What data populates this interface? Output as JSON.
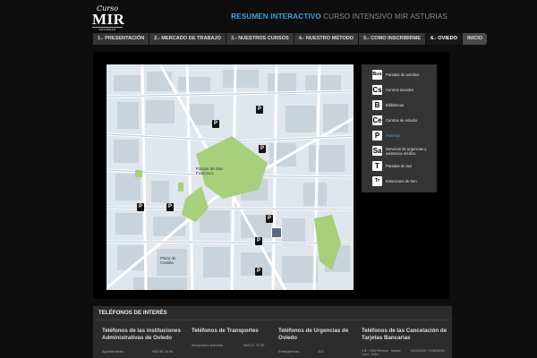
{
  "logo": {
    "script": "Curso",
    "big": "MIR",
    "small": "ASTURIAS"
  },
  "header": {
    "highlight": "RESUMEN INTERACTIVO",
    "rest": "CURSO INTENSIVO MIR ASTURIAS"
  },
  "nav": [
    {
      "label": "1.- PRESENTACIÓN"
    },
    {
      "label": "2.- MERCADO DE TRABAJO"
    },
    {
      "label": "3.- NUESTROS CURSOS"
    },
    {
      "label": "4.- NUESTRO MÉTODO"
    },
    {
      "label": "5.- COMO INSCRIBIRME"
    },
    {
      "label": "6.- OVIEDO"
    },
    {
      "label": "INICIO"
    }
  ],
  "legend": [
    {
      "icon": "Bus",
      "label": "Paradas de autobus"
    },
    {
      "icon": "Cs",
      "label": "Centros sociales"
    },
    {
      "icon": "B",
      "label": "Bibliotecas"
    },
    {
      "icon": "Ce",
      "label": "Centros de estudio"
    },
    {
      "icon": "P",
      "label": "Parkings"
    },
    {
      "icon": "Sa",
      "label": "Servicios de urgencias y asistencia médica"
    },
    {
      "icon": "T",
      "label": "Paradas de taxi"
    },
    {
      "icon": "Tr",
      "label": "Estaciones de tren"
    }
  ],
  "map": {
    "park_label": "Parque de San Francisco",
    "plaza_label": "Plaza de Castilla"
  },
  "phones": {
    "header": "TELÉFONOS DE INTERÉS",
    "columns": [
      {
        "title": "Teléfonos de las instituciones Administrativas de Oviedo",
        "rows": [
          {
            "name": "Ayuntamiento",
            "value": "985 98 18 00"
          }
        ]
      },
      {
        "title": "Teléfonos de Transportes",
        "rows": [
          {
            "name": "Aeropuerto Asturias",
            "value": "985 12 75 00"
          }
        ]
      },
      {
        "title": "Teléfonos de Urgencias de Oviedo",
        "rows": [
          {
            "name": "Emergencias",
            "value": "112"
          }
        ]
      },
      {
        "title": "Teléfonos de las Cancelación de Tarjetas Bancarias",
        "rows": [
          {
            "name": "4 B - VISA Electron - Master Card - VISA",
            "value": "902114400 / 913626200"
          }
        ]
      }
    ]
  }
}
